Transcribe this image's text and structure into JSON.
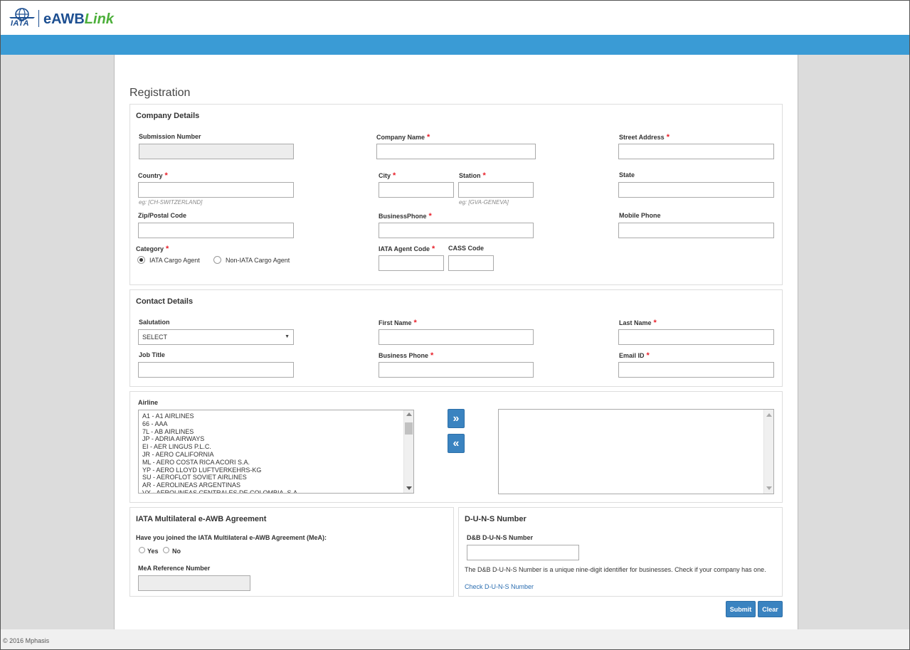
{
  "brand": {
    "iata": "IATA",
    "product_prefix": "eAWB",
    "product_suffix": "Link",
    "accent": "#3a9bd5",
    "green": "#4caf3a"
  },
  "page_title": "Registration",
  "company": {
    "title": "Company Details",
    "submission_number": {
      "label": "Submission Number",
      "value": ""
    },
    "company_name": {
      "label": "Company Name",
      "value": ""
    },
    "street_address": {
      "label": "Street Address",
      "value": ""
    },
    "country": {
      "label": "Country",
      "value": "",
      "hint": "eg: [CH-SWITZERLAND]"
    },
    "city": {
      "label": "City",
      "value": ""
    },
    "station": {
      "label": "Station",
      "value": "",
      "hint": "eg: [GVA-GENEVA]"
    },
    "state": {
      "label": "State",
      "value": ""
    },
    "zip": {
      "label": "Zip/Postal Code",
      "value": ""
    },
    "business_phone": {
      "label": "BusinessPhone",
      "value": ""
    },
    "mobile_phone": {
      "label": "Mobile Phone",
      "value": ""
    },
    "category": {
      "label": "Category",
      "options": [
        "IATA Cargo Agent",
        "Non-IATA Cargo Agent"
      ],
      "selected": "IATA Cargo Agent"
    },
    "iata_agent_code": {
      "label": "IATA Agent Code",
      "value": ""
    },
    "cass_code": {
      "label": "CASS Code",
      "value": ""
    }
  },
  "contact": {
    "title": "Contact Details",
    "salutation": {
      "label": "Salutation",
      "value": "SELECT"
    },
    "first_name": {
      "label": "First Name",
      "value": ""
    },
    "last_name": {
      "label": "Last Name",
      "value": ""
    },
    "job_title": {
      "label": "Job Title",
      "value": ""
    },
    "business_phone": {
      "label": "Business Phone",
      "value": ""
    },
    "email": {
      "label": "Email ID",
      "value": ""
    }
  },
  "airline": {
    "label": "Airline",
    "available": [
      "A1 - A1 AIRLINES",
      "66 - AAA",
      "7L - AB AIRLINES",
      "JP - ADRIA AIRWAYS",
      "EI - AER LINGUS P.L.C.",
      "JR - AERO CALIFORNIA",
      "ML - AERO COSTA RICA ACORI S.A.",
      "YP - AERO LLOYD LUFTVERKEHRS-KG",
      "SU - AEROFLOT SOVIET AIRLINES",
      "AR - AEROLINEAS ARGENTINAS",
      "VX - AEROLINEAS CENTRALES DE COLOMBIA, S.A."
    ],
    "selected": []
  },
  "mea": {
    "title": "IATA Multilateral e-AWB Agreement",
    "question": "Have you joined the IATA Multilateral e-AWB Agreement (MeA):",
    "options": [
      "Yes",
      "No"
    ],
    "ref_label": "MeA Reference Number",
    "ref_value": ""
  },
  "duns": {
    "title": "D-U-N-S Number",
    "label": "D&B D-U-N-S Number",
    "value": "",
    "description": "The D&B D-U-N-S Number is a unique nine-digit identifier for businesses. Check if your company has one.",
    "link": "Check D-U-N-S Number"
  },
  "actions": {
    "submit": "Submit",
    "clear": "Clear"
  },
  "footer": {
    "copyright": "© 2016 Mphasis"
  }
}
